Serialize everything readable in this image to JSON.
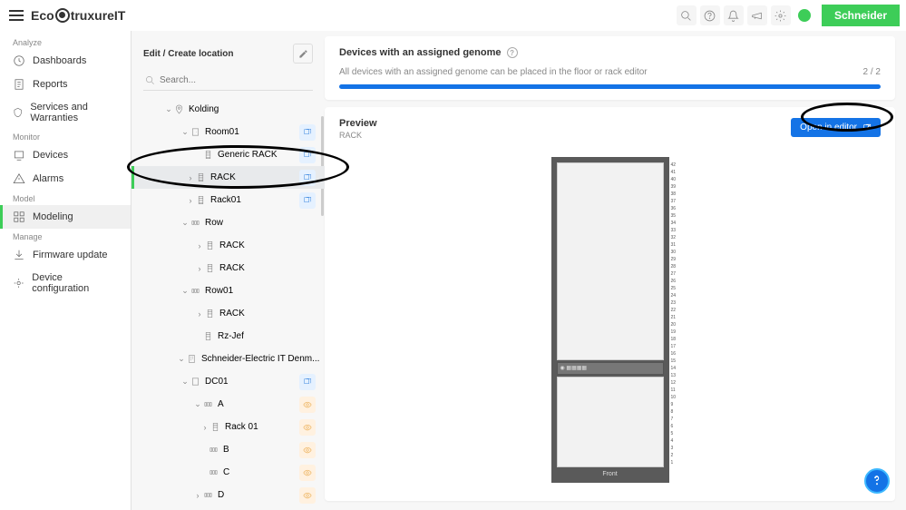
{
  "brand": {
    "logo_prefix": "Eco",
    "logo_mid": "truxure",
    "logo_suffix": " IT",
    "badge": "Schneider"
  },
  "sidebar": {
    "sections": {
      "analyze": "Analyze",
      "monitor": "Monitor",
      "model": "Model",
      "manage": "Manage"
    },
    "items": {
      "dashboards": "Dashboards",
      "reports": "Reports",
      "services": "Services and Warranties",
      "devices": "Devices",
      "alarms": "Alarms",
      "modeling": "Modeling",
      "firmware": "Firmware update",
      "devconf": "Device configuration"
    }
  },
  "tree": {
    "header": "Edit / Create location",
    "search_placeholder": "Search...",
    "nodes": {
      "kolding": "Kolding",
      "room01": "Room01",
      "generic_rack": "Generic RACK",
      "rack_sel": "RACK",
      "rack01": "Rack01",
      "row": "Row",
      "rack_a": "RACK",
      "rack_b": "RACK",
      "row01": "Row01",
      "rack_c": "RACK",
      "rzjef": "Rz-Jef",
      "seit": "Schneider-Electric IT Denm...",
      "dc01": "DC01",
      "a": "A",
      "rack_01": "Rack 01",
      "b": "B",
      "c": "C",
      "d": "D"
    }
  },
  "genome": {
    "title": "Devices with an assigned genome",
    "desc": "All devices with an assigned genome can be placed in the floor or rack editor",
    "count": "2 / 2"
  },
  "preview": {
    "title": "Preview",
    "subtitle": "RACK",
    "open_button": "Open in editor",
    "rack_label": "Front"
  },
  "rack_units": [
    "42",
    "41",
    "40",
    "39",
    "38",
    "37",
    "36",
    "35",
    "34",
    "33",
    "32",
    "31",
    "30",
    "29",
    "28",
    "27",
    "26",
    "25",
    "24",
    "23",
    "22",
    "21",
    "20",
    "19",
    "18",
    "17",
    "16",
    "15",
    "14",
    "13",
    "12",
    "11",
    "10",
    "9",
    "8",
    "7",
    "6",
    "5",
    "4",
    "3",
    "2",
    "1"
  ]
}
